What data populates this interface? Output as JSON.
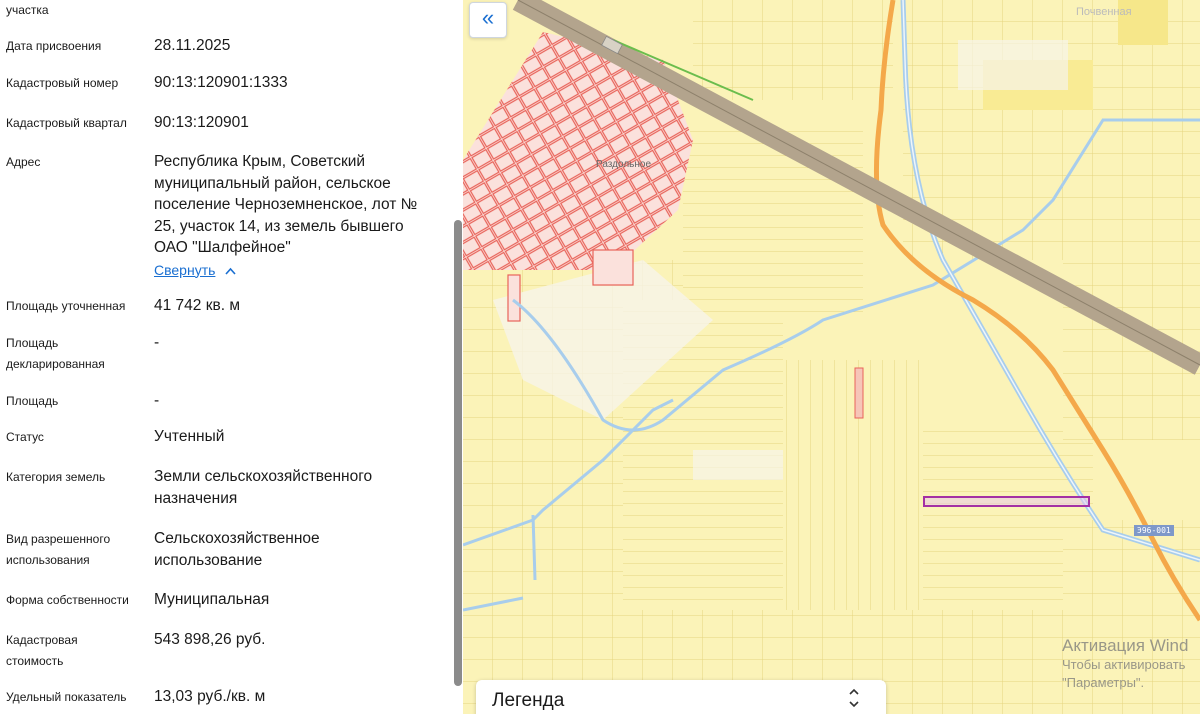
{
  "panel": {
    "fields": [
      {
        "label": "участка",
        "value": ""
      },
      {
        "label": "Дата присвоения",
        "value": "28.11.2025"
      },
      {
        "label": "Кадастровый номер",
        "value": "90:13:120901:1333"
      },
      {
        "label": "Кадастровый квартал",
        "value": "90:13:120901"
      },
      {
        "label": "Адрес",
        "value_lines": [
          "Республика Крым, Советский",
          "муниципальный район, сельское",
          "поселение Черноземненское, лот №",
          "25, участок 14, из земель бывшего",
          "ОАО \"Шалфейное\""
        ]
      },
      {
        "label": "Площадь уточненная",
        "value": "41 742 кв. м"
      },
      {
        "label_lines": [
          "Площадь",
          "декларированная"
        ],
        "value": "-"
      },
      {
        "label": "Площадь",
        "value": "-"
      },
      {
        "label": "Статус",
        "value": "Учтенный"
      },
      {
        "label": "Категория земель",
        "value_lines": [
          "Земли сельскохозяйственного",
          "назначения"
        ]
      },
      {
        "label_lines": [
          "Вид разрешенного",
          "использования"
        ],
        "value_lines": [
          "Сельскохозяйственное",
          "использование"
        ]
      },
      {
        "label": "Форма собственности",
        "value": "Муниципальная"
      },
      {
        "label_lines": [
          "Кадастровая",
          "стоимость"
        ],
        "value": "543 898,26 руб."
      },
      {
        "label": "Удельный показатель",
        "value": "13,03 руб./кв. м"
      }
    ],
    "collapse_link": "Свернуть",
    "collapse_icon": "chevron-up-icon"
  },
  "map": {
    "collapse_button_icon": "double-chevron-left-icon",
    "collapse_button_glyph": "«",
    "village_label": "Раздольное",
    "road_badge": "Э96-001",
    "top_right_label": "Почвенная",
    "legend": {
      "title": "Легенда",
      "icon": "chevron-up-down-icon"
    },
    "colors": {
      "parcel_fill": "#fbf3b8",
      "parcel_stroke": "#e3cf6e",
      "settlement": "#e8635a",
      "railway": "#b3a48d",
      "highway": "#f4a84a",
      "canal": "#a8cdec",
      "selected_parcel": "#a430a4"
    }
  },
  "watermark": {
    "line1": "Активация Wind",
    "line2": "Чтобы активировать",
    "line3": "\"Параметры\"."
  }
}
